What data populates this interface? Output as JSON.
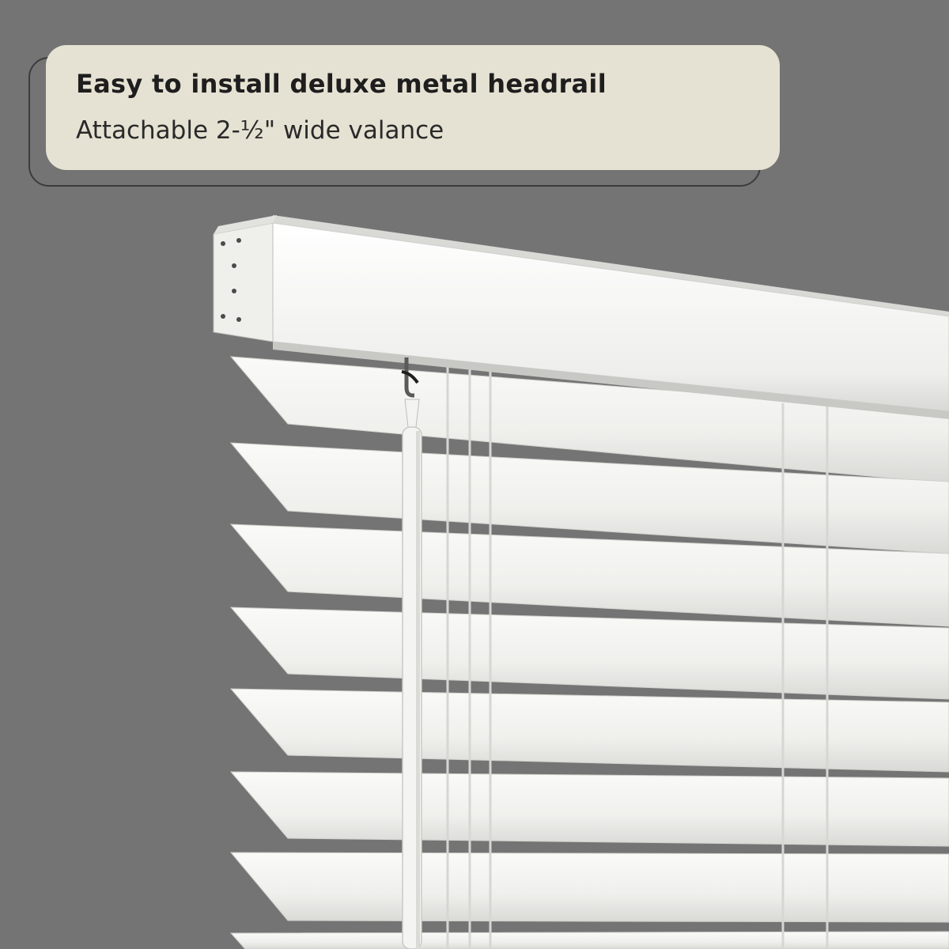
{
  "callout": {
    "title": "Easy to install deluxe metal headrail",
    "subtitle": "Attachable 2-½\" wide valance"
  },
  "colors": {
    "background": "#747474",
    "callout_fill": "#e6e2d3",
    "slat_white": "#f3f3f1"
  },
  "icons": [
    "headrail-image",
    "wand-image",
    "slats-image"
  ]
}
